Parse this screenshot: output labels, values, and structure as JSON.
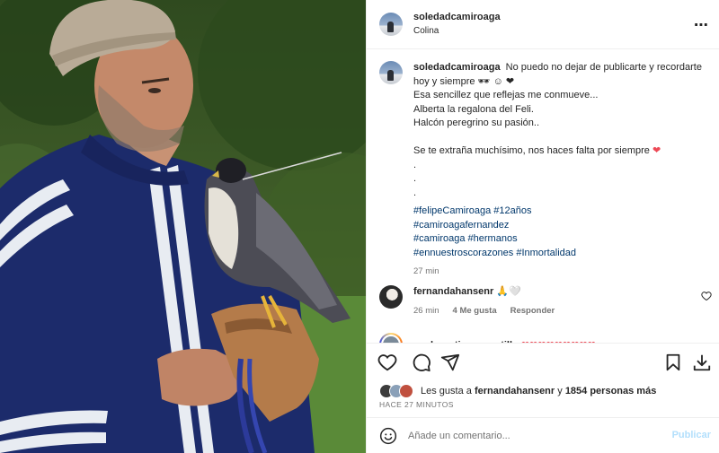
{
  "post": {
    "author": "soledadcamiroaga",
    "location": "Colina",
    "more_icon": "more-horizontal-icon"
  },
  "caption": {
    "author": "soledadcamiroaga",
    "first_line": "No puedo no dejar de publicarte y recordarte hoy y siempre",
    "emojis_first": "🕶 ☺ ❤",
    "lines": [
      "Esa sencillez que reflejas me conmueve...",
      "Alberta la regalona del Feli.",
      "Halcón peregrino su pasión..",
      "",
      "Se te extraña muchísimo, nos haces falta por siempre"
    ],
    "heart": "❤",
    "dots": [
      ".",
      ".",
      "."
    ],
    "hashtags": [
      "#felipeCamiroaga #12años",
      "#camiroagafernandez",
      "#camiroaga #hermanos",
      "#ennuestroscorazones #Inmortalidad"
    ],
    "time": "27 min"
  },
  "comments": [
    {
      "author": "fernandahansenr",
      "text": "🙏🤍",
      "time": "26 min",
      "likes": "4 Me gusta",
      "reply": "Responder"
    },
    {
      "author": "pachogutierrezcastillo",
      "text": "❤❤❤❤❤❤❤❤❤"
    }
  ],
  "actions": {
    "icons": [
      "heart-icon",
      "comment-icon",
      "share-icon",
      "bookmark-icon",
      "download-icon"
    ],
    "likes_prefix": "Les gusta a",
    "likes_user": "fernandahansenr",
    "likes_mid": "y",
    "likes_count": "1854 personas más",
    "posted_ago": "HACE 27 MINUTOS",
    "comment_placeholder": "Añade un comentario...",
    "publish_label": "Publicar"
  },
  "colors": {
    "link": "#00376b",
    "heart": "#ed4956",
    "muted": "#737373",
    "publish_disabled": "#b2dffc"
  }
}
